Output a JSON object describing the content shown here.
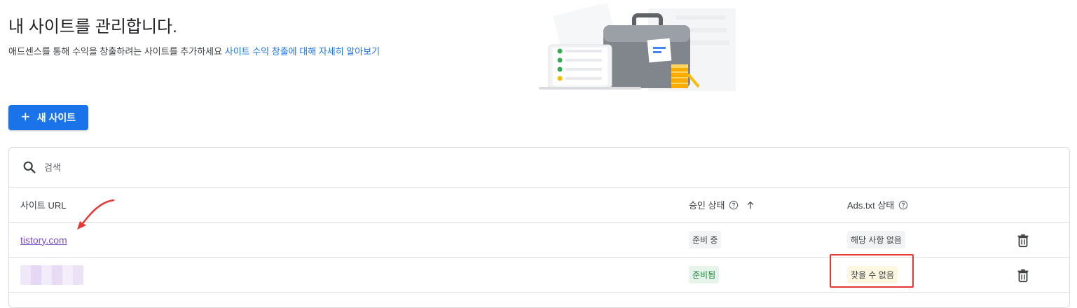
{
  "page": {
    "title": "내 사이트를 관리합니다.",
    "subtitle_text": "애드센스를 통해 수익을 창출하려는 사이트를 추가하세요",
    "subtitle_link": "사이트 수익 창출에 대해 자세히 알아보기"
  },
  "toolbar": {
    "new_site_label": "새 사이트",
    "new_site_icon": "plus-icon"
  },
  "search": {
    "placeholder": "검색",
    "icon": "search-icon"
  },
  "table": {
    "columns": {
      "url": "사이트 URL",
      "approval": "승인 상태",
      "ads_txt": "Ads.txt 상태"
    },
    "rows": [
      {
        "url": "tistory.com",
        "approval": "준비 중",
        "ads_txt": "해당 사항 없음"
      },
      {
        "url": "",
        "approval": "준비됨",
        "ads_txt": "찾을 수 없음"
      }
    ]
  },
  "colors": {
    "primary": "#1a73e8",
    "link_visited": "#7b4ec4",
    "approval_ready_bg": "#e6f4ea",
    "ads_txt_missing_bg": "#fef7e0",
    "annotation_red": "#e53935"
  }
}
